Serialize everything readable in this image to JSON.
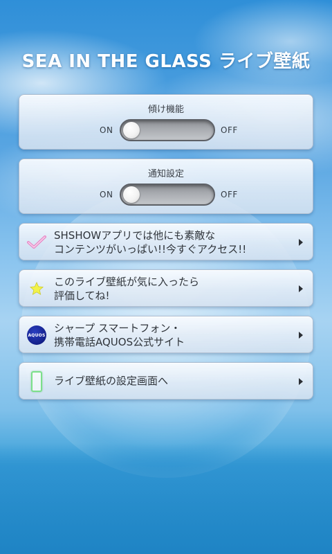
{
  "app": {
    "title": "SEA IN THE GLASS ライブ壁紙"
  },
  "toggles": [
    {
      "label": "傾け機能",
      "on_label": "ON",
      "off_label": "OFF",
      "state": "off"
    },
    {
      "label": "通知設定",
      "on_label": "ON",
      "off_label": "OFF",
      "state": "off"
    }
  ],
  "links": [
    {
      "icon": "checkmark-icon",
      "line1": "SHSHOWアプリでは他にも素敵な",
      "line2": "コンテンツがいっぱい!!今すぐアクセス!!"
    },
    {
      "icon": "star-icon",
      "line1": "このライブ壁紙が気に入ったら",
      "line2": "評価してね!"
    },
    {
      "icon": "aquos-icon",
      "icon_text": "AQUOS",
      "line1": "シャープ スマートフォン・",
      "line2": "携帯電話AQUOS公式サイト"
    },
    {
      "icon": "phone-icon",
      "line1": "ライブ壁紙の設定画面へ"
    }
  ],
  "colors": {
    "sky_blue": "#2f8fd8",
    "panel_bg": "#e4ecf6",
    "checkmark_pink": "#e88ac8",
    "star_yellow": "#f2f24a",
    "aquos_blue": "#13208a",
    "phone_green": "#7ce08a"
  }
}
